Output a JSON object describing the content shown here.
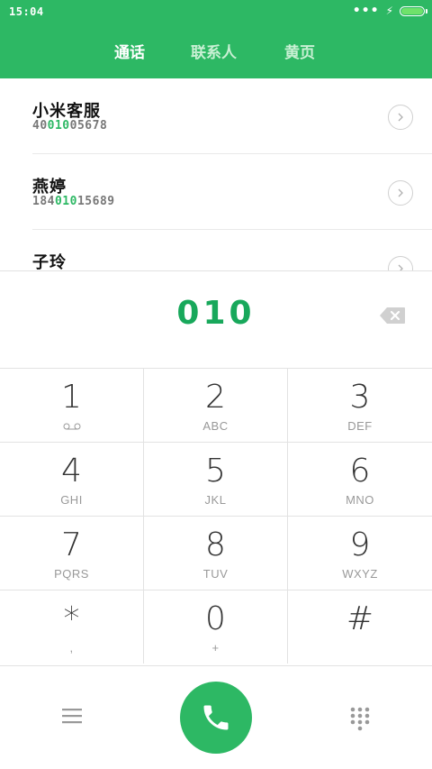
{
  "status": {
    "time": "15:04",
    "battery_color": "#6fe26b"
  },
  "tabs": [
    {
      "label": "通话",
      "active": true
    },
    {
      "label": "联系人",
      "active": false
    },
    {
      "label": "黄页",
      "active": false
    }
  ],
  "results": [
    {
      "name": "小米客服",
      "num_prefix": "40",
      "num_match": "010",
      "num_suffix": "05678"
    },
    {
      "name": "燕婷",
      "num_prefix": "184",
      "num_match": "010",
      "num_suffix": "15689"
    },
    {
      "name": "子玲",
      "num_prefix": "",
      "num_match": "",
      "num_suffix": ""
    }
  ],
  "dialer": {
    "entered": "010",
    "keys": [
      {
        "digit": "1",
        "letters": ""
      },
      {
        "digit": "2",
        "letters": "ABC"
      },
      {
        "digit": "3",
        "letters": "DEF"
      },
      {
        "digit": "4",
        "letters": "GHI"
      },
      {
        "digit": "5",
        "letters": "JKL"
      },
      {
        "digit": "6",
        "letters": "MNO"
      },
      {
        "digit": "7",
        "letters": "PQRS"
      },
      {
        "digit": "8",
        "letters": "TUV"
      },
      {
        "digit": "9",
        "letters": "WXYZ"
      },
      {
        "digit": "*",
        "letters": ","
      },
      {
        "digit": "0",
        "letters": "+"
      },
      {
        "digit": "#",
        "letters": ""
      }
    ]
  },
  "colors": {
    "accent": "#2db864",
    "digits": "#18a85b"
  }
}
